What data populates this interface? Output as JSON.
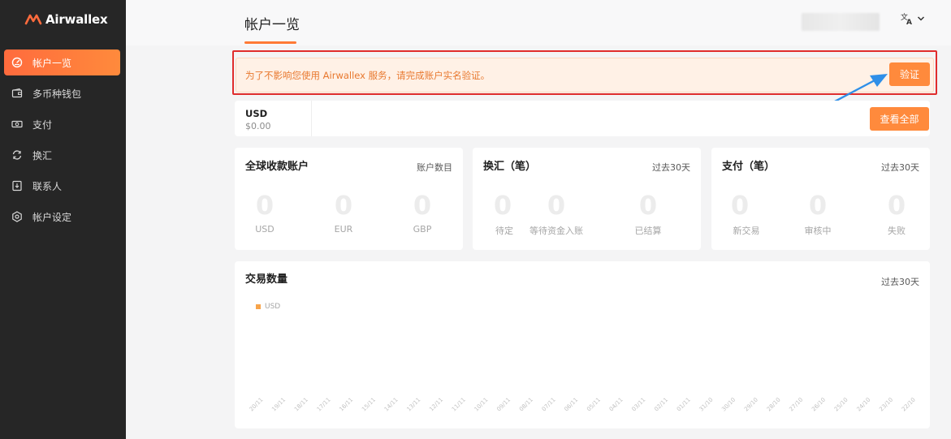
{
  "brand": {
    "name": "Airwallex",
    "accent": "#ff6b3d"
  },
  "sidebar": {
    "items": [
      {
        "label": "帐户一览",
        "icon": "gauge-icon",
        "active": true
      },
      {
        "label": "多币种钱包",
        "icon": "wallet-icon",
        "active": false
      },
      {
        "label": "支付",
        "icon": "banknote-icon",
        "active": false
      },
      {
        "label": "换汇",
        "icon": "exchange-icon",
        "active": false
      },
      {
        "label": "联系人",
        "icon": "contacts-icon",
        "active": false
      },
      {
        "label": "帐户设定",
        "icon": "settings-gear-icon",
        "active": false
      }
    ]
  },
  "header": {
    "title": "帐户一览",
    "language_icon": "translate-icon"
  },
  "alert": {
    "text": "为了不影响您使用 Airwallex 服务，请完成账户实名验证。",
    "button": "验证"
  },
  "balance": {
    "currency": "USD",
    "amount": "$0.00",
    "view_all": "查看全部"
  },
  "cards": [
    {
      "title": "全球收款账户",
      "meta": "账户数目",
      "items": [
        {
          "value": "0",
          "label": "USD"
        },
        {
          "value": "0",
          "label": "EUR"
        },
        {
          "value": "0",
          "label": "GBP"
        }
      ]
    },
    {
      "title": "换汇（笔）",
      "meta": "过去30天",
      "items": [
        {
          "value": "0",
          "label": "待定"
        },
        {
          "value": "0",
          "label": "等待资金入账"
        },
        {
          "value": "0",
          "label": "已结算"
        }
      ]
    },
    {
      "title": "支付（笔）",
      "meta": "过去30天",
      "items": [
        {
          "value": "0",
          "label": "新交易"
        },
        {
          "value": "0",
          "label": "审核中"
        },
        {
          "value": "0",
          "label": "失败"
        }
      ]
    }
  ],
  "chart": {
    "title": "交易数量",
    "meta": "过去30天",
    "legend": "USD",
    "series_color": "#f7a44b"
  },
  "chart_data": {
    "type": "bar",
    "title": "交易数量",
    "xlabel": "",
    "ylabel": "",
    "categories": [
      "20/11",
      "19/11",
      "18/11",
      "17/11",
      "16/11",
      "15/11",
      "14/11",
      "13/11",
      "12/11",
      "11/11",
      "10/11",
      "09/11",
      "08/11",
      "07/11",
      "06/11",
      "05/11",
      "04/11",
      "03/11",
      "02/11",
      "01/11",
      "31/10",
      "30/10",
      "29/10",
      "28/10",
      "27/10",
      "26/10",
      "25/10",
      "24/10",
      "23/10",
      "22/10"
    ],
    "series": [
      {
        "name": "USD",
        "values": [
          0,
          0,
          0,
          0,
          0,
          0,
          0,
          0,
          0,
          0,
          0,
          0,
          0,
          0,
          0,
          0,
          0,
          0,
          0,
          0,
          0,
          0,
          0,
          0,
          0,
          0,
          0,
          0,
          0,
          0
        ]
      }
    ],
    "grid": false,
    "legend_position": "top-left"
  }
}
